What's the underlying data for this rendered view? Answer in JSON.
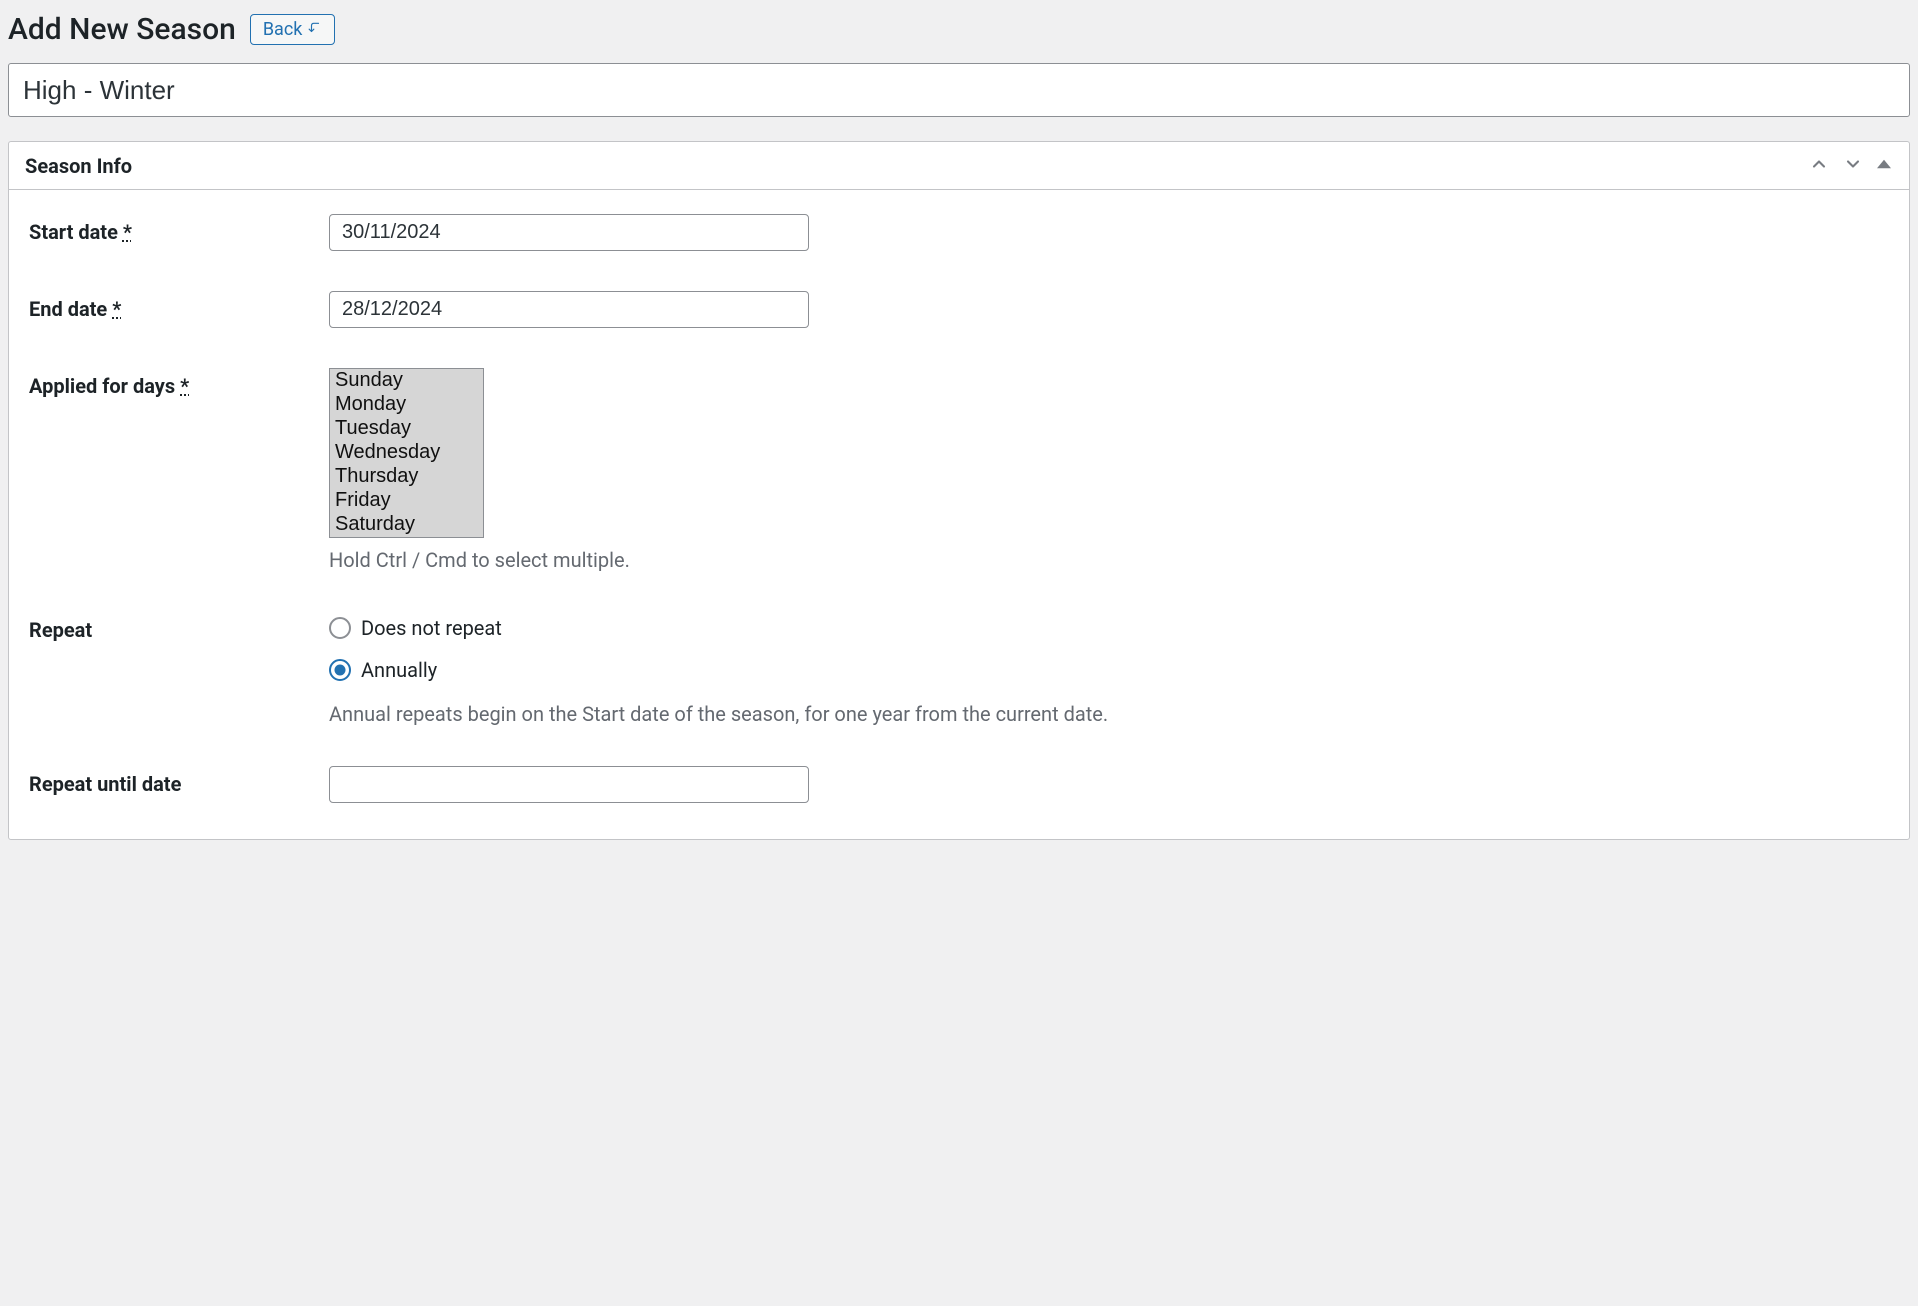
{
  "header": {
    "page_title": "Add New Season",
    "back_label": "Back"
  },
  "title_field": {
    "value": "High - Winter"
  },
  "panel": {
    "title": "Season Info"
  },
  "form": {
    "start_date": {
      "label": "Start date",
      "required_marker": "*",
      "value": "30/11/2024"
    },
    "end_date": {
      "label": "End date",
      "required_marker": "*",
      "value": "28/12/2024"
    },
    "applied_days": {
      "label": "Applied for days",
      "required_marker": "*",
      "options": [
        "Sunday",
        "Monday",
        "Tuesday",
        "Wednesday",
        "Thursday",
        "Friday",
        "Saturday"
      ],
      "help": "Hold Ctrl / Cmd to select multiple."
    },
    "repeat": {
      "label": "Repeat",
      "option_none": "Does not repeat",
      "option_annual": "Annually",
      "selected": "annual",
      "help": "Annual repeats begin on the Start date of the season, for one year from the current date."
    },
    "repeat_until": {
      "label": "Repeat until date",
      "value": ""
    }
  }
}
